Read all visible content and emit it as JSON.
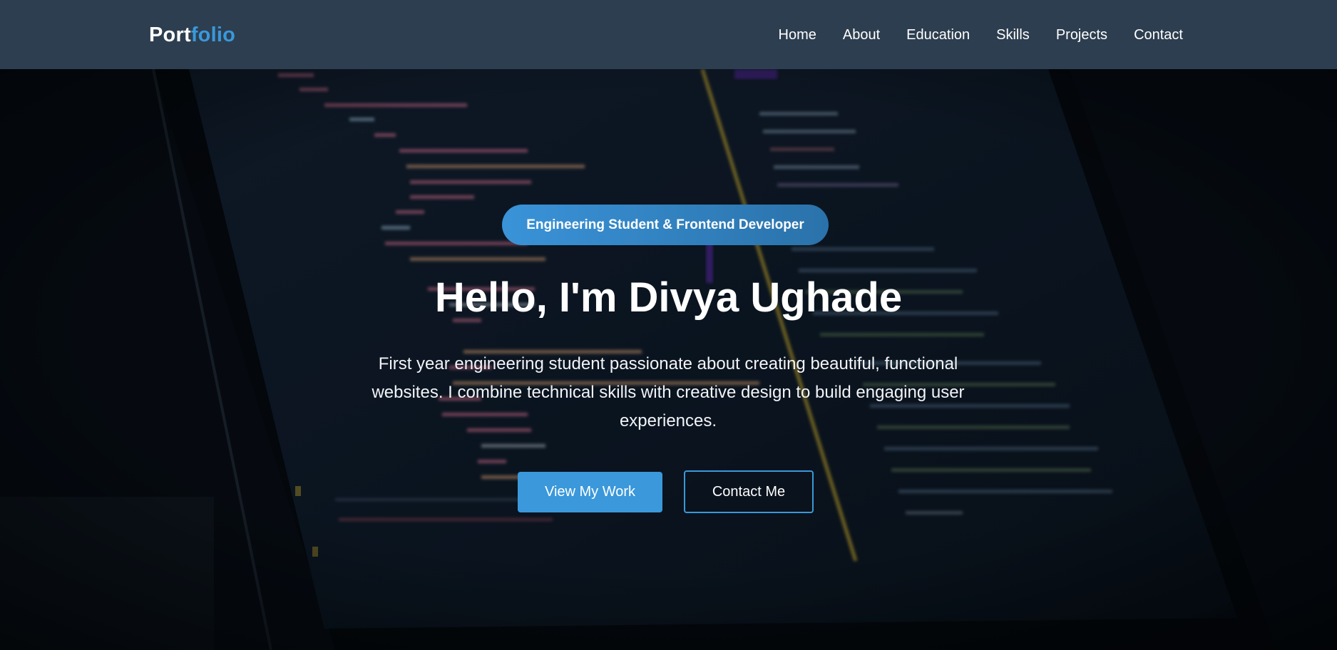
{
  "nav": {
    "logo_part1": "Port",
    "logo_part2": "folio",
    "links": [
      "Home",
      "About",
      "Education",
      "Skills",
      "Projects",
      "Contact"
    ]
  },
  "hero": {
    "badge": "Engineering Student & Frontend Developer",
    "title": "Hello, I'm Divya Ughade",
    "description": "First year engineering student passionate about creating beautiful, functional websites. I combine technical skills with creative design to build engaging user experiences.",
    "primary_button": "View My Work",
    "secondary_button": "Contact Me"
  },
  "colors": {
    "navbar_bg": "#2d3e50",
    "accent": "#3a98db",
    "text": "#ffffff"
  }
}
